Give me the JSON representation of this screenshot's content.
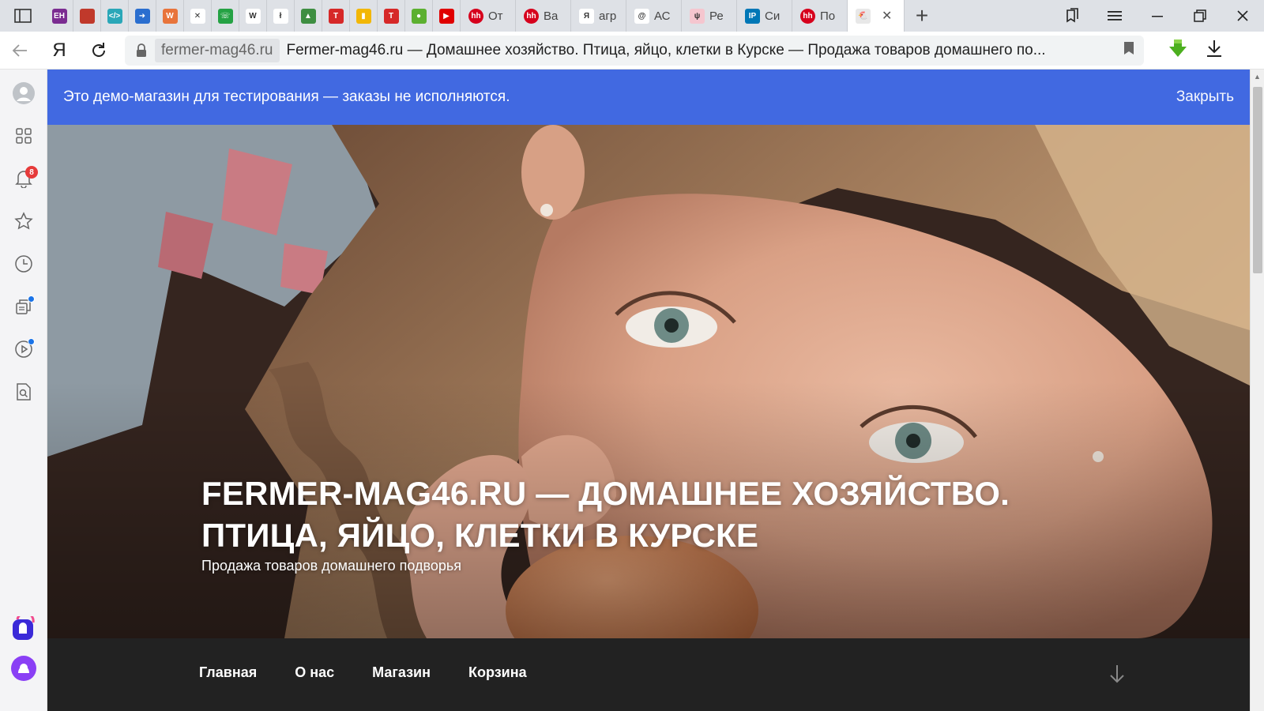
{
  "browser": {
    "tabs": [
      {
        "icon": "eh-icon",
        "color": "#7b2c91",
        "glyph": "ЕН",
        "title": ""
      },
      {
        "icon": "blocks-icon",
        "color": "#c0392b",
        "glyph": "",
        "title": ""
      },
      {
        "icon": "code-icon",
        "color": "#2aa7b8",
        "glyph": "</>",
        "title": ""
      },
      {
        "icon": "arrow-icon",
        "color": "#2a6ecf",
        "glyph": "➜",
        "title": ""
      },
      {
        "icon": "wordpress-icon",
        "color": "#e8743b",
        "glyph": "W",
        "title": ""
      },
      {
        "icon": "circle-x-icon",
        "color": "#ffffff",
        "glyph": "✕",
        "title": ""
      },
      {
        "icon": "whatsapp-icon",
        "color": "#25a244",
        "glyph": "☏",
        "title": ""
      },
      {
        "icon": "word-icon",
        "color": "#ffffff",
        "glyph": "W",
        "title": ""
      },
      {
        "icon": "feather-icon",
        "color": "#ffffff",
        "glyph": "ł",
        "title": ""
      },
      {
        "icon": "mound-icon",
        "color": "#3e8e41",
        "glyph": "▲",
        "title": ""
      },
      {
        "icon": "t-icon",
        "color": "#d62828",
        "glyph": "T",
        "title": ""
      },
      {
        "icon": "bars-icon",
        "color": "#f2b705",
        "glyph": "▮",
        "title": ""
      },
      {
        "icon": "t2-icon",
        "color": "#d62828",
        "glyph": "T",
        "title": ""
      },
      {
        "icon": "leaf-icon",
        "color": "#5cb030",
        "glyph": "●",
        "title": ""
      },
      {
        "icon": "youtube-icon",
        "color": "#e00000",
        "glyph": "▶",
        "title": ""
      },
      {
        "icon": "hh-icon",
        "color": "#d6001c",
        "glyph": "hh",
        "title": "От",
        "wide": true
      },
      {
        "icon": "hh-icon",
        "color": "#d6001c",
        "glyph": "hh",
        "title": "Ва",
        "wide": true
      },
      {
        "icon": "yandex-icon",
        "color": "#ffffff",
        "glyph": "Я",
        "title": "агр",
        "wide": true
      },
      {
        "icon": "swirl-icon",
        "color": "#ffffff",
        "glyph": "@",
        "title": "АС",
        "wide": true
      },
      {
        "icon": "pink-circle-icon",
        "color": "#f5c6cf",
        "glyph": "ψ",
        "title": "Ре",
        "wide": true
      },
      {
        "icon": "ip-icon",
        "color": "#0077b6",
        "glyph": "IP",
        "title": "Си",
        "wide": true
      },
      {
        "icon": "hh-icon",
        "color": "#d6001c",
        "glyph": "hh",
        "title": "По",
        "wide": true
      }
    ],
    "active_tab": {
      "icon": "chicken-icon",
      "close": "✕"
    },
    "address": {
      "domain": "fermer-mag46.ru",
      "page_title": "Fermer-mag46.ru — Домашнее хозяйство. Птица, яйцо, клетки в Курске — Продажа товаров домашнего по..."
    },
    "yandex_letter": "Я",
    "notifications_badge": "8"
  },
  "page": {
    "demo_banner": {
      "text": "Это демо-магазин для тестирования — заказы не исполняются.",
      "close": "Закрыть"
    },
    "hero": {
      "title_line1": "FERMER-MAG46.RU — ДОМАШНЕЕ ХОЗЯЙСТВО.",
      "title_line2": "ПТИЦА, ЯЙЦО, КЛЕТКИ В КУРСКЕ",
      "tagline": "Продажа товаров домашнего подворья"
    },
    "menu": [
      "Главная",
      "О нас",
      "Магазин",
      "Корзина"
    ]
  },
  "colors": {
    "banner": "#4169e1",
    "nav_bg": "#222222",
    "tab_strip": "#dee1e6"
  }
}
